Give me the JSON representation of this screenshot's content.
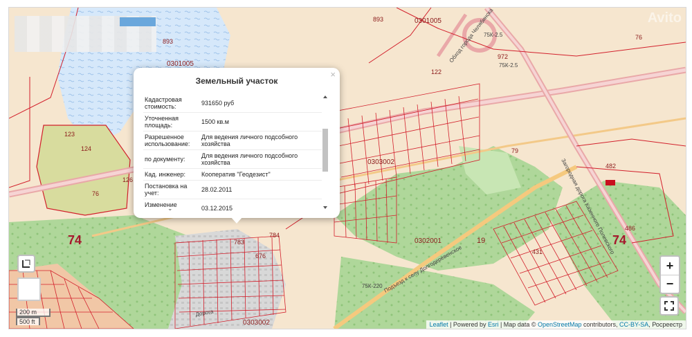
{
  "popup": {
    "title": "Земельный участок",
    "close": "×",
    "rows": [
      {
        "key": "Кадастровая стоимость:",
        "value": "931650 руб"
      },
      {
        "key": "Уточненная площадь:",
        "value": "1500 кв.м"
      },
      {
        "key": "Разрешенное использование:",
        "value": "Для ведения личного подсобного хозяйства"
      },
      {
        "key": "по документу:",
        "value": "Для ведения личного подсобного хозяйства"
      },
      {
        "key": "Кад. инженер:",
        "value": "Кооператив \"Геодезист\""
      },
      {
        "key": "Постановка на учет:",
        "value": "28.02.2011"
      },
      {
        "key": "Изменение сведений:",
        "value": "03.12.2015"
      }
    ]
  },
  "map": {
    "region_labels": [
      "74",
      "74"
    ],
    "quarter_labels": [
      "0301005",
      "0301005",
      "0303002",
      "0302001",
      "0303002",
      "19"
    ],
    "parcel_labels": [
      "893",
      "893",
      "123",
      "124",
      "126",
      "76",
      "76",
      "79",
      "482",
      "486",
      "431",
      "783",
      "784",
      "676",
      "122",
      "972"
    ],
    "road_labels": [
      "Обход города Челябинска",
      "75К-2.5",
      "75К-2.5",
      "Подъезд к селу Долгодеревенское",
      "75К-220",
      "Загородная дорога Казенного Полевского",
      "Дорога"
    ],
    "watermark": "Avito"
  },
  "controls": {
    "zoom_in": "+",
    "zoom_out": "−",
    "layers_icon": "layers-icon",
    "fullscreen_icon": "fullscreen-icon"
  },
  "scale": {
    "metric": "200 m",
    "imperial": "500 ft"
  },
  "attribution": {
    "leaflet": "Leaflet",
    "sep1": " | Powered by ",
    "esri": "Esri",
    "sep2": " | Map data © ",
    "osm": "OpenStreetMap",
    "sep3": " contributors, ",
    "license": "CC-BY-SA",
    "sep4": ", Росреестр"
  },
  "colors": {
    "boundary": "#d21f2b",
    "forest": "#a9d48f",
    "water": "#c9dff5",
    "land": "#f6e6cf",
    "road": "#f3c988"
  }
}
